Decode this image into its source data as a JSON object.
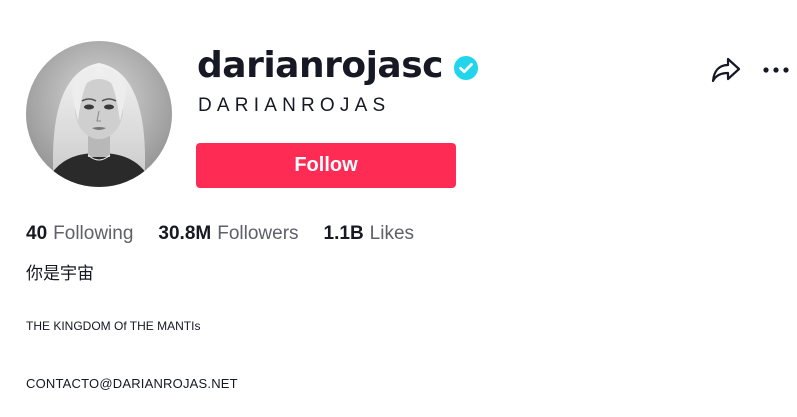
{
  "profile": {
    "username": "darianrojasc",
    "display_name": "DARIANROJAS",
    "verified": true,
    "verified_color": "#20d5ec",
    "follow_label": "Follow",
    "follow_color": "#fe2c55"
  },
  "stats": {
    "following_value": "40",
    "following_label": "Following",
    "followers_value": "30.8M",
    "followers_label": "Followers",
    "likes_value": "1.1B",
    "likes_label": "Likes"
  },
  "bio": {
    "line1": "你是宇宙",
    "line2": "THE KINGDOM Of THE MANTIs",
    "line3": "CONTACTO@DARIANROJAS.NET"
  },
  "icons": {
    "share": "share-icon",
    "more": "more-icon",
    "verified": "verified-badge-icon"
  }
}
